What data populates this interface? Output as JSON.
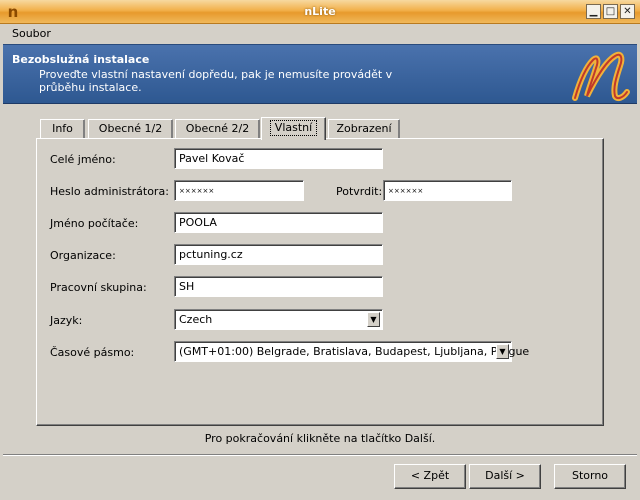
{
  "window": {
    "title": "nLite",
    "icon": "nlite-n-icon"
  },
  "menu": {
    "items": [
      "Soubor"
    ]
  },
  "header": {
    "title": "Bezobslužná instalace",
    "description": "Proveďte vlastní nastavení dopředu, pak je nemusíte provádět v průběhu instalace."
  },
  "tabs": [
    {
      "label": "Info",
      "active": false
    },
    {
      "label": "Obecné 1/2",
      "active": false
    },
    {
      "label": "Obecné 2/2",
      "active": false
    },
    {
      "label": "Vlastní",
      "active": true
    },
    {
      "label": "Zobrazení",
      "active": false
    }
  ],
  "form": {
    "full_name": {
      "label": "Celé jméno:",
      "value": "Pavel Kovač"
    },
    "admin_password": {
      "label": "Heslo administrátora:",
      "value": "××××××"
    },
    "confirm_password": {
      "label": "Potvrdit:",
      "value": "××××××"
    },
    "computer_name": {
      "label": "Jméno počítače:",
      "value": "POOLA"
    },
    "organization": {
      "label": "Organizace:",
      "value": "pctuning.cz"
    },
    "workgroup": {
      "label": "Pracovní skupina:",
      "value": "SH"
    },
    "language": {
      "label": "Jazyk:",
      "value": "Czech"
    },
    "timezone": {
      "label": "Časové pásmo:",
      "value": "(GMT+01:00) Belgrade, Bratislava, Budapest, Ljubljana, Prague"
    }
  },
  "hint": "Pro pokračování klikněte na tlačítko Další.",
  "buttons": {
    "back": "< Zpět",
    "next": "Další >",
    "cancel": "Storno"
  },
  "colors": {
    "titlebar": "#f2b04a",
    "banner": "#3d66a3",
    "face": "#d4d0c8"
  }
}
